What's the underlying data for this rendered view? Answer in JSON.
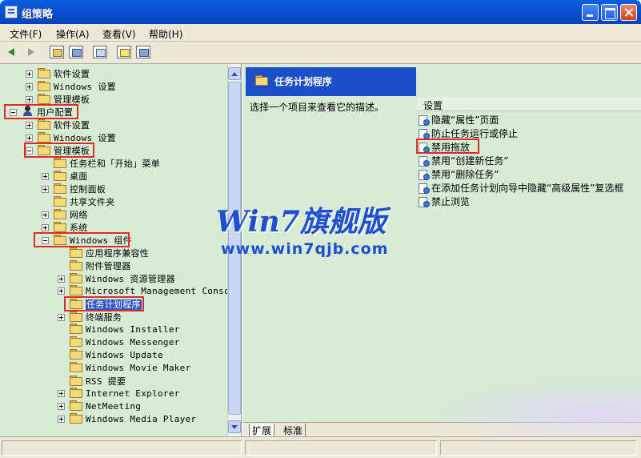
{
  "window": {
    "title": "组策略"
  },
  "menubar": {
    "items": [
      "文件(F)",
      "操作(A)",
      "查看(V)",
      "帮助(H)"
    ]
  },
  "tree": {
    "rows": [
      {
        "label": "软件设置",
        "expander": "plus",
        "level": 2
      },
      {
        "label": "Windows 设置",
        "expander": "plus",
        "level": 2
      },
      {
        "label": "管理模板",
        "expander": "plus",
        "level": 2
      },
      {
        "label": "用户配置",
        "expander": "minus",
        "level": 0,
        "icon": "user"
      },
      {
        "label": "软件设置",
        "expander": "plus",
        "level": 2
      },
      {
        "label": "Windows 设置",
        "expander": "plus",
        "level": 2
      },
      {
        "label": "管理模板",
        "expander": "minus",
        "level": 2
      },
      {
        "label": "任务栏和「开始」菜单",
        "expander": "none",
        "level": 3
      },
      {
        "label": "桌面",
        "expander": "plus",
        "level": 3
      },
      {
        "label": "控制面板",
        "expander": "plus",
        "level": 3
      },
      {
        "label": "共享文件夹",
        "expander": "none",
        "level": 3
      },
      {
        "label": "网络",
        "expander": "plus",
        "level": 3
      },
      {
        "label": "系统",
        "expander": "plus",
        "level": 3
      },
      {
        "label": "Windows 组件",
        "expander": "minus",
        "level": 3
      },
      {
        "label": "应用程序兼容性",
        "expander": "none",
        "level": 4
      },
      {
        "label": "附件管理器",
        "expander": "none",
        "level": 4
      },
      {
        "label": "Windows 资源管理器",
        "expander": "plus",
        "level": 4
      },
      {
        "label": "Microsoft Management Console",
        "expander": "plus",
        "level": 4
      },
      {
        "label": "任务计划程序",
        "expander": "none",
        "level": 4,
        "selected": true
      },
      {
        "label": "终端服务",
        "expander": "plus",
        "level": 4
      },
      {
        "label": "Windows Installer",
        "expander": "none",
        "level": 4
      },
      {
        "label": "Windows Messenger",
        "expander": "none",
        "level": 4
      },
      {
        "label": "Windows Update",
        "expander": "none",
        "level": 4
      },
      {
        "label": "Windows Movie Maker",
        "expander": "none",
        "level": 4
      },
      {
        "label": "RSS 提要",
        "expander": "none",
        "level": 4
      },
      {
        "label": "Internet Explorer",
        "expander": "plus",
        "level": 4
      },
      {
        "label": "NetMeeting",
        "expander": "plus",
        "level": 4
      },
      {
        "label": "Windows Media Player",
        "expander": "plus",
        "level": 4
      }
    ]
  },
  "right": {
    "header_title": "任务计划程序",
    "description": "选择一个项目来查看它的描述。",
    "column_header": "设置",
    "settings": [
      "隐藏“属性”页面",
      "防止任务运行或停止",
      "禁用拖放",
      "禁用“创建新任务”",
      "禁用“删除任务”",
      "在添加任务计划向导中隐藏“高级属性”复选框",
      "禁止浏览"
    ]
  },
  "tabs": [
    "扩展",
    "标准"
  ],
  "watermark": {
    "main": "Win7旗舰版",
    "url": "www.win7qjb.com"
  },
  "colors": {
    "selection": "#2f57c6",
    "header": "#1a4fc9",
    "highlight_box": "#e02a2a",
    "pane_bg": "#d7ebd5"
  }
}
